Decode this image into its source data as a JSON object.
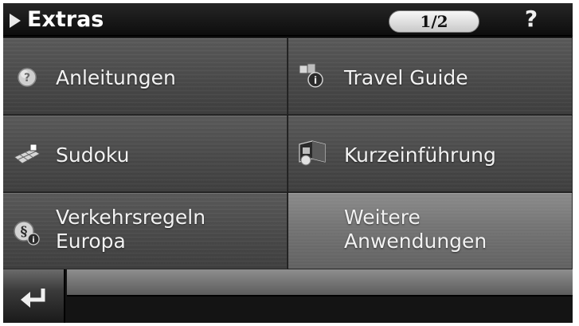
{
  "titlebar": {
    "title": "Extras",
    "page_indicator": "1/2",
    "help_label": "?"
  },
  "menu": [
    {
      "label_line1": "Anleitungen",
      "label_line2": "",
      "icon": "question-icon"
    },
    {
      "label_line1": "Travel Guide",
      "label_line2": "",
      "icon": "travel-guide-icon"
    },
    {
      "label_line1": "Sudoku",
      "label_line2": "",
      "icon": "sudoku-icon"
    },
    {
      "label_line1": "Kurzeinführung",
      "label_line2": "",
      "icon": "quick-start-icon"
    },
    {
      "label_line1": "Verkehrsregeln",
      "label_line2": "Europa",
      "icon": "traffic-rules-icon"
    },
    {
      "label_line1": "Weitere",
      "label_line2": "Anwendungen",
      "icon": ""
    }
  ],
  "bottombar": {
    "back_icon": "return-arrow-icon"
  },
  "colors": {
    "titlebar_bg": "#141414",
    "tile_bg": "#4e4e4e",
    "tile_highlight_bg": "#747474",
    "text": "#f2f2f2"
  }
}
